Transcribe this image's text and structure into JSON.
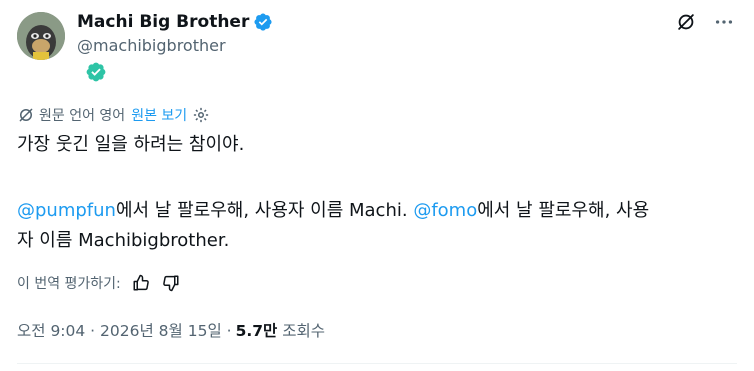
{
  "author": {
    "display_name": "Machi Big Brother",
    "handle": "@machibigbrother",
    "avatar_icon": "bored-ape-avatar-icon",
    "verified_color": "#1d9bf0",
    "affiliate_badge_icon": "affiliate-verified-badge-icon"
  },
  "header_icons": [
    "grok-slash-icon",
    "more-options-icon"
  ],
  "translation": {
    "original_language_label": "원문 언어 영어",
    "view_original_link": "원본 보기"
  },
  "tweet": {
    "line1": "가장 웃긴 일을 하려는 참이야.",
    "mention1": "@pumpfun",
    "line2_rest": "에서 날 팔로우해, 사용자 이름 Machi. ",
    "mention2": "@fomo",
    "line2_tail": "에서 날 팔로우해, 사용",
    "line3": "자 이름 Machibigbrother."
  },
  "rating": {
    "label": "이 번역 평가하기:"
  },
  "meta": {
    "timestamp": "오전 9:04 · 2026년 8월 15일 · ",
    "views_count": "5.7만",
    "views_label": "조회수"
  },
  "colors": {
    "accent": "#1d9bf0",
    "text": "#0f1419",
    "secondary": "#536471"
  }
}
